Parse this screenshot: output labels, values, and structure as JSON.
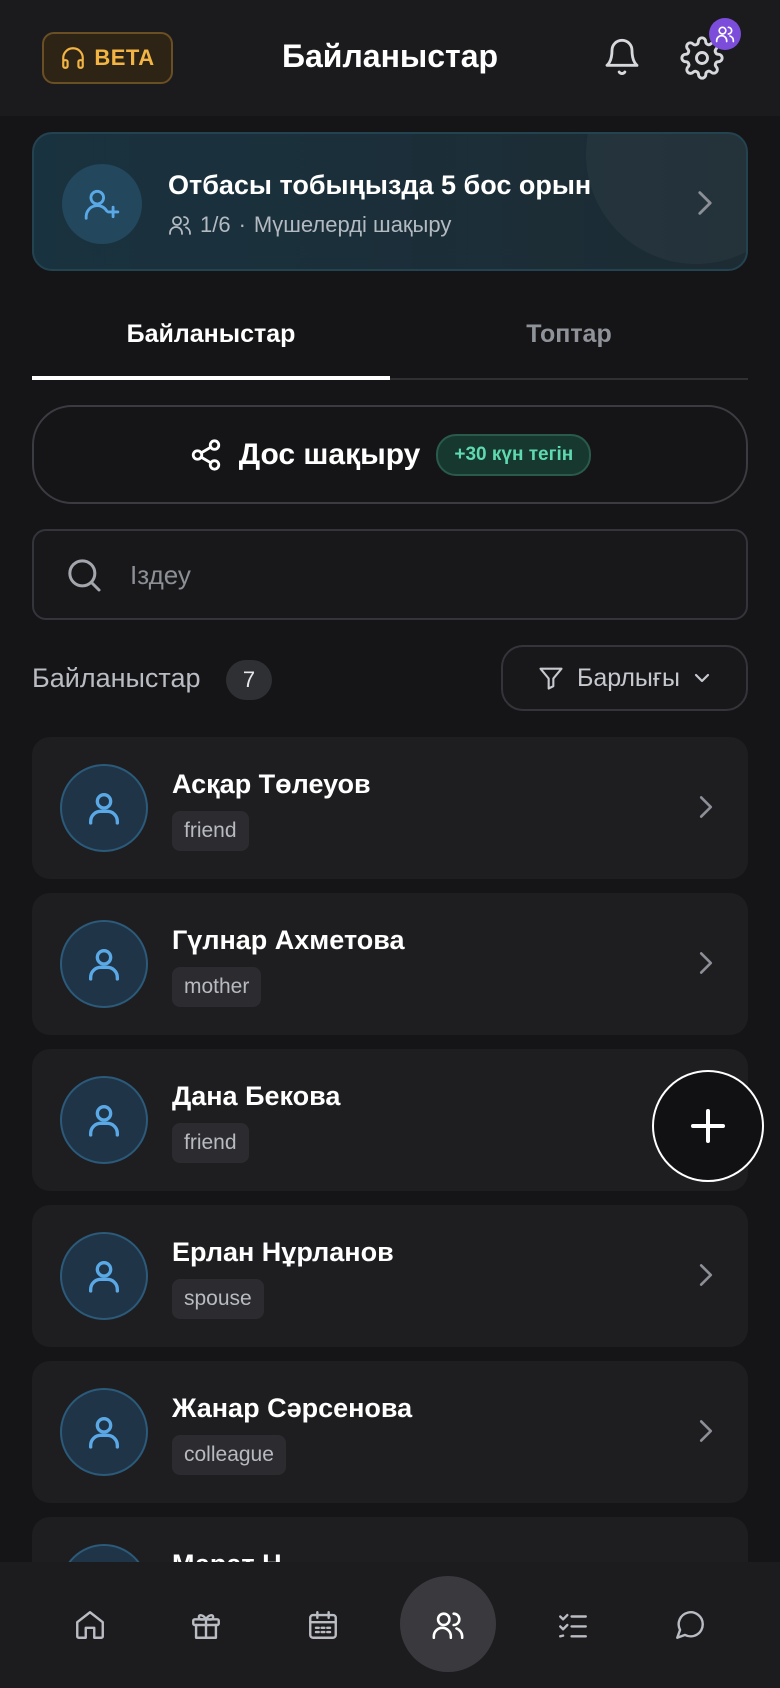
{
  "header": {
    "beta_label": "BETA",
    "title": "Байланыстар",
    "icons": [
      "headphones-icon",
      "bell-icon",
      "gear-icon",
      "users-badge-icon"
    ]
  },
  "family_banner": {
    "title": "Отбасы тобыңызда 5 бос орын",
    "count": "1/6",
    "separator": "·",
    "action": "Мүшелерді шақыру"
  },
  "tabs": [
    {
      "label": "Байланыстар",
      "active": true
    },
    {
      "label": "Топтар",
      "active": false
    }
  ],
  "invite": {
    "label": "Дос шақыру",
    "badge": "+30 күн тегін"
  },
  "search": {
    "placeholder": "Іздеу",
    "value": ""
  },
  "contacts_section": {
    "title": "Байланыстар",
    "count": "7",
    "filter_label": "Барлығы"
  },
  "contacts": [
    {
      "name": "Асқар Төлеуов",
      "tag": "friend"
    },
    {
      "name": "Гүлнар Ахметова",
      "tag": "mother"
    },
    {
      "name": "Дана Бекова",
      "tag": "friend"
    },
    {
      "name": "Ерлан Нұрланов",
      "tag": "spouse"
    },
    {
      "name": "Жанар Сәрсенова",
      "tag": "colleague"
    },
    {
      "name": "Марат Н",
      "tag": ""
    }
  ],
  "bottom_nav": {
    "items": [
      "home-icon",
      "gift-icon",
      "calendar-icon",
      "contacts-icon",
      "tasks-icon",
      "chat-icon"
    ],
    "active": "contacts-icon"
  },
  "colors": {
    "background": "#151517",
    "accent_blue": "#5aa9e6",
    "beta_gold": "#f2b544",
    "badge_green": "#5fdab0",
    "badge_purple": "#7c4ddb"
  }
}
